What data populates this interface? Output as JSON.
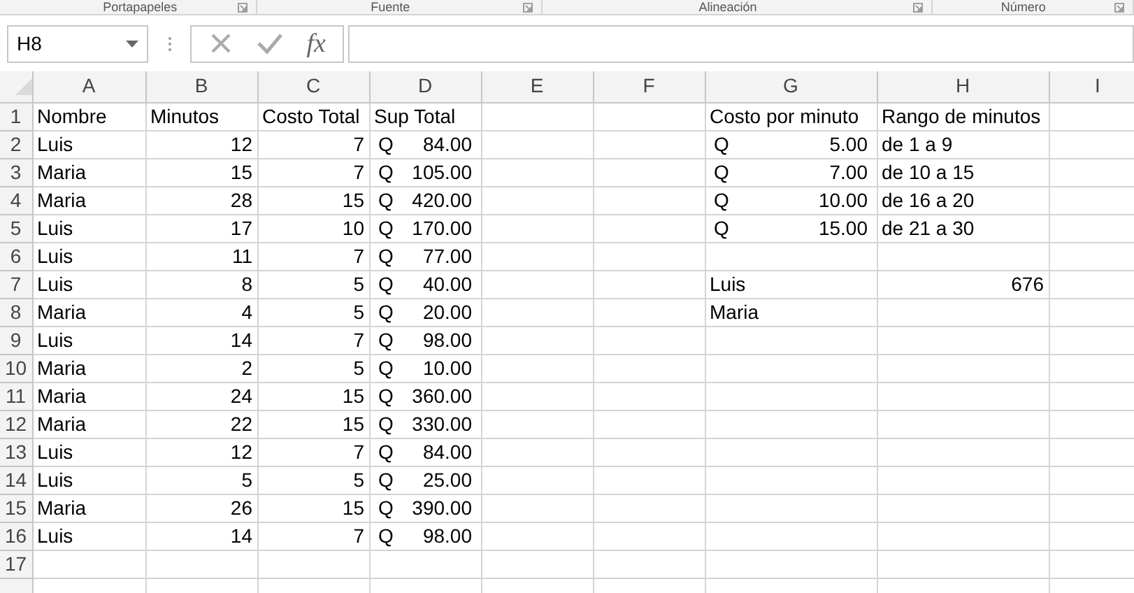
{
  "ribbon_groups": [
    "Portapapeles",
    "Fuente",
    "Alineación",
    "Número"
  ],
  "name_box": {
    "value": "H8"
  },
  "formula_buttons": {
    "fx": "fx"
  },
  "column_headers": [
    "A",
    "B",
    "C",
    "D",
    "E",
    "F",
    "G",
    "H",
    "I"
  ],
  "rows": [
    {
      "header": "1",
      "cells": {
        "col_a": {
          "kind": "text",
          "text": "Nombre"
        },
        "col_b": {
          "kind": "text",
          "text": "Minutos"
        },
        "col_c": {
          "kind": "text",
          "text": "Costo Total"
        },
        "col_d": {
          "kind": "text",
          "text": "Sup Total"
        },
        "col_g": {
          "kind": "text",
          "text": "Costo por minuto"
        },
        "col_h": {
          "kind": "text",
          "text": "Rango de minutos"
        }
      }
    },
    {
      "header": "2",
      "cells": {
        "col_a": {
          "kind": "text",
          "text": "Luis"
        },
        "col_b": {
          "kind": "number",
          "text": "12"
        },
        "col_c": {
          "kind": "number",
          "text": "7"
        },
        "col_d": {
          "kind": "currency",
          "symbol": "Q",
          "text": "84.00"
        },
        "col_g": {
          "kind": "currency",
          "symbol": "Q",
          "text": "5.00"
        },
        "col_h": {
          "kind": "text",
          "text": "de 1 a 9"
        }
      }
    },
    {
      "header": "3",
      "cells": {
        "col_a": {
          "kind": "text",
          "text": "Maria"
        },
        "col_b": {
          "kind": "number",
          "text": "15"
        },
        "col_c": {
          "kind": "number",
          "text": "7"
        },
        "col_d": {
          "kind": "currency",
          "symbol": "Q",
          "text": "105.00"
        },
        "col_g": {
          "kind": "currency",
          "symbol": "Q",
          "text": "7.00"
        },
        "col_h": {
          "kind": "text",
          "text": "de 10 a 15"
        }
      }
    },
    {
      "header": "4",
      "cells": {
        "col_a": {
          "kind": "text",
          "text": "Maria"
        },
        "col_b": {
          "kind": "number",
          "text": "28"
        },
        "col_c": {
          "kind": "number",
          "text": "15"
        },
        "col_d": {
          "kind": "currency",
          "symbol": "Q",
          "text": "420.00"
        },
        "col_g": {
          "kind": "currency",
          "symbol": "Q",
          "text": "10.00"
        },
        "col_h": {
          "kind": "text",
          "text": "de 16 a 20"
        }
      }
    },
    {
      "header": "5",
      "cells": {
        "col_a": {
          "kind": "text",
          "text": "Luis"
        },
        "col_b": {
          "kind": "number",
          "text": "17"
        },
        "col_c": {
          "kind": "number",
          "text": "10"
        },
        "col_d": {
          "kind": "currency",
          "symbol": "Q",
          "text": "170.00"
        },
        "col_g": {
          "kind": "currency",
          "symbol": "Q",
          "text": "15.00"
        },
        "col_h": {
          "kind": "text",
          "text": "de 21 a 30"
        }
      }
    },
    {
      "header": "6",
      "cells": {
        "col_a": {
          "kind": "text",
          "text": "Luis"
        },
        "col_b": {
          "kind": "number",
          "text": "11"
        },
        "col_c": {
          "kind": "number",
          "text": "7"
        },
        "col_d": {
          "kind": "currency",
          "symbol": "Q",
          "text": "77.00"
        }
      }
    },
    {
      "header": "7",
      "cells": {
        "col_a": {
          "kind": "text",
          "text": "Luis"
        },
        "col_b": {
          "kind": "number",
          "text": "8"
        },
        "col_c": {
          "kind": "number",
          "text": "5"
        },
        "col_d": {
          "kind": "currency",
          "symbol": "Q",
          "text": "40.00"
        },
        "col_g": {
          "kind": "text",
          "text": "Luis"
        },
        "col_h": {
          "kind": "number",
          "text": "676"
        }
      }
    },
    {
      "header": "8",
      "cells": {
        "col_a": {
          "kind": "text",
          "text": "Maria"
        },
        "col_b": {
          "kind": "number",
          "text": "4"
        },
        "col_c": {
          "kind": "number",
          "text": "5"
        },
        "col_d": {
          "kind": "currency",
          "symbol": "Q",
          "text": "20.00"
        },
        "col_g": {
          "kind": "text",
          "text": "Maria"
        }
      }
    },
    {
      "header": "9",
      "cells": {
        "col_a": {
          "kind": "text",
          "text": "Luis"
        },
        "col_b": {
          "kind": "number",
          "text": "14"
        },
        "col_c": {
          "kind": "number",
          "text": "7"
        },
        "col_d": {
          "kind": "currency",
          "symbol": "Q",
          "text": "98.00"
        }
      }
    },
    {
      "header": "10",
      "cells": {
        "col_a": {
          "kind": "text",
          "text": "Maria"
        },
        "col_b": {
          "kind": "number",
          "text": "2"
        },
        "col_c": {
          "kind": "number",
          "text": "5"
        },
        "col_d": {
          "kind": "currency",
          "symbol": "Q",
          "text": "10.00"
        }
      }
    },
    {
      "header": "11",
      "cells": {
        "col_a": {
          "kind": "text",
          "text": "Maria"
        },
        "col_b": {
          "kind": "number",
          "text": "24"
        },
        "col_c": {
          "kind": "number",
          "text": "15"
        },
        "col_d": {
          "kind": "currency",
          "symbol": "Q",
          "text": "360.00"
        }
      }
    },
    {
      "header": "12",
      "cells": {
        "col_a": {
          "kind": "text",
          "text": "Maria"
        },
        "col_b": {
          "kind": "number",
          "text": "22"
        },
        "col_c": {
          "kind": "number",
          "text": "15"
        },
        "col_d": {
          "kind": "currency",
          "symbol": "Q",
          "text": "330.00"
        }
      }
    },
    {
      "header": "13",
      "cells": {
        "col_a": {
          "kind": "text",
          "text": "Luis"
        },
        "col_b": {
          "kind": "number",
          "text": "12"
        },
        "col_c": {
          "kind": "number",
          "text": "7"
        },
        "col_d": {
          "kind": "currency",
          "symbol": "Q",
          "text": "84.00"
        }
      }
    },
    {
      "header": "14",
      "cells": {
        "col_a": {
          "kind": "text",
          "text": "Luis"
        },
        "col_b": {
          "kind": "number",
          "text": "5"
        },
        "col_c": {
          "kind": "number",
          "text": "5"
        },
        "col_d": {
          "kind": "currency",
          "symbol": "Q",
          "text": "25.00"
        }
      }
    },
    {
      "header": "15",
      "cells": {
        "col_a": {
          "kind": "text",
          "text": "Maria"
        },
        "col_b": {
          "kind": "number",
          "text": "26"
        },
        "col_c": {
          "kind": "number",
          "text": "15"
        },
        "col_d": {
          "kind": "currency",
          "symbol": "Q",
          "text": "390.00"
        }
      }
    },
    {
      "header": "16",
      "cells": {
        "col_a": {
          "kind": "text",
          "text": "Luis"
        },
        "col_b": {
          "kind": "number",
          "text": "14"
        },
        "col_c": {
          "kind": "number",
          "text": "7"
        },
        "col_d": {
          "kind": "currency",
          "symbol": "Q",
          "text": "98.00"
        }
      }
    },
    {
      "header": "17",
      "cells": {}
    }
  ]
}
